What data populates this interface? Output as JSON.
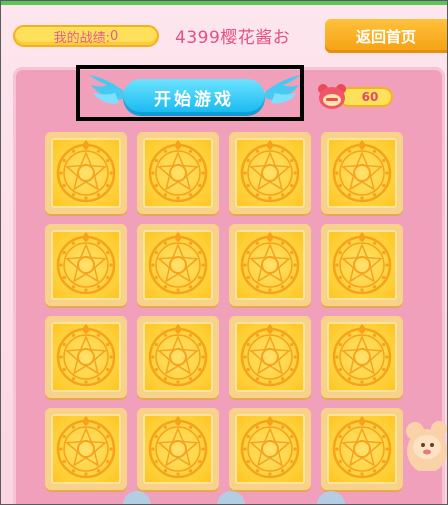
{
  "header": {
    "score_label": "我的战绩:",
    "score_value": "0",
    "user_name": "4399樱花酱お",
    "home_label": "返回首页"
  },
  "game": {
    "start_label": "开始游戏",
    "counter_value": "60",
    "card_rows": 4,
    "card_cols": 4,
    "card_state": "face-down"
  },
  "colors": {
    "accent_pink": "#e4507f",
    "start_blue": "#14b7ef",
    "home_orange": "#f5a012",
    "card_gold": "#ffd23c",
    "board_pink": "#f1a0bb"
  },
  "icons": {
    "counter": "bear-face-icon",
    "wings": "wing-icon",
    "card_back": "magic-circle-icon"
  }
}
